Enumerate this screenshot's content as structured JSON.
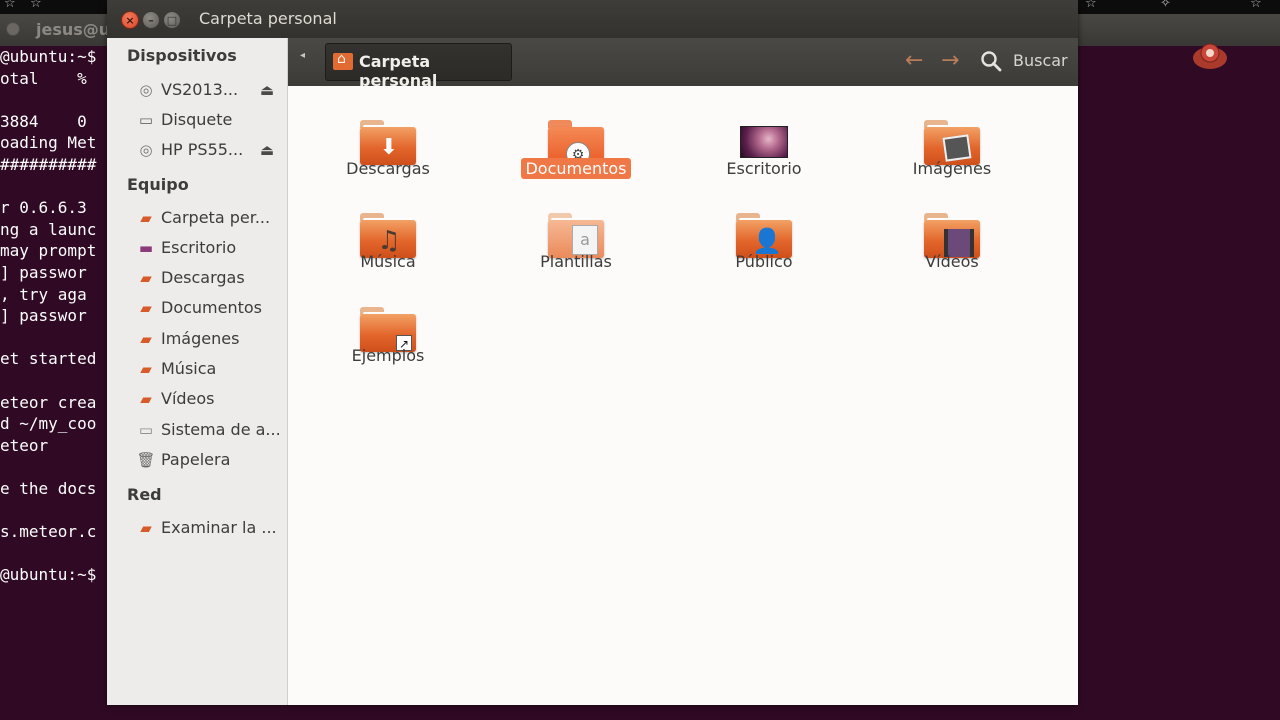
{
  "desktop": {
    "terminal_title": "jesus@u",
    "terminal_lines": [
      "@ubuntu:~$",
      "otal    %",
      "",
      "3884    0",
      "oading Met",
      "##########",
      "",
      "r 0.6.6.3",
      "ng a launc",
      "may prompt",
      "] passwor",
      ", try aga",
      "] passwor",
      "",
      "et started",
      "",
      "eteor crea",
      "d ~/my_coo",
      "eteor",
      "",
      "e the docs",
      "",
      "s.meteor.c",
      "",
      "@ubuntu:~$"
    ]
  },
  "window": {
    "title": "Carpeta personal",
    "close_label": "×",
    "min_label": "–",
    "max_label": "□"
  },
  "toolbar": {
    "breadcrumb": "Carpeta personal",
    "search_label": "Buscar"
  },
  "sidebar": {
    "sections": [
      {
        "heading": "Dispositivos",
        "items": [
          {
            "label": "VS2013...",
            "icon": "optical-drive-icon",
            "eject": true
          },
          {
            "label": "Disquete",
            "icon": "floppy-icon",
            "eject": false
          },
          {
            "label": "HP PS55...",
            "icon": "optical-drive-icon",
            "eject": true
          }
        ]
      },
      {
        "heading": "Equipo",
        "items": [
          {
            "label": "Carpeta per...",
            "icon": "home-folder-icon"
          },
          {
            "label": "Escritorio",
            "icon": "desktop-icon"
          },
          {
            "label": "Descargas",
            "icon": "downloads-folder-icon"
          },
          {
            "label": "Documentos",
            "icon": "documents-folder-icon"
          },
          {
            "label": "Imágenes",
            "icon": "pictures-folder-icon"
          },
          {
            "label": "Música",
            "icon": "music-folder-icon"
          },
          {
            "label": "Vídeos",
            "icon": "videos-folder-icon"
          },
          {
            "label": "Sistema de a...",
            "icon": "filesystem-icon"
          },
          {
            "label": "Papelera",
            "icon": "trash-icon"
          }
        ]
      },
      {
        "heading": "Red",
        "items": [
          {
            "label": "Examinar la ...",
            "icon": "network-icon"
          }
        ]
      }
    ]
  },
  "files": [
    {
      "label": "Descargas",
      "icon": "downloads-folder-icon",
      "selected": false
    },
    {
      "label": "Documentos",
      "icon": "documents-folder-icon",
      "selected": true
    },
    {
      "label": "Escritorio",
      "icon": "desktop-icon",
      "selected": false
    },
    {
      "label": "Imágenes",
      "icon": "pictures-folder-icon",
      "selected": false
    },
    {
      "label": "Música",
      "icon": "music-folder-icon",
      "selected": false
    },
    {
      "label": "Plantillas",
      "icon": "templates-folder-icon",
      "selected": false
    },
    {
      "label": "Público",
      "icon": "public-folder-icon",
      "selected": false
    },
    {
      "label": "Vídeos",
      "icon": "videos-folder-icon",
      "selected": false
    },
    {
      "label": "Ejemplos",
      "icon": "examples-folder-icon",
      "selected": false
    }
  ],
  "colors": {
    "accent": "#f07746",
    "folder_orange": "#e3662c",
    "terminal_bg": "#300a24"
  }
}
